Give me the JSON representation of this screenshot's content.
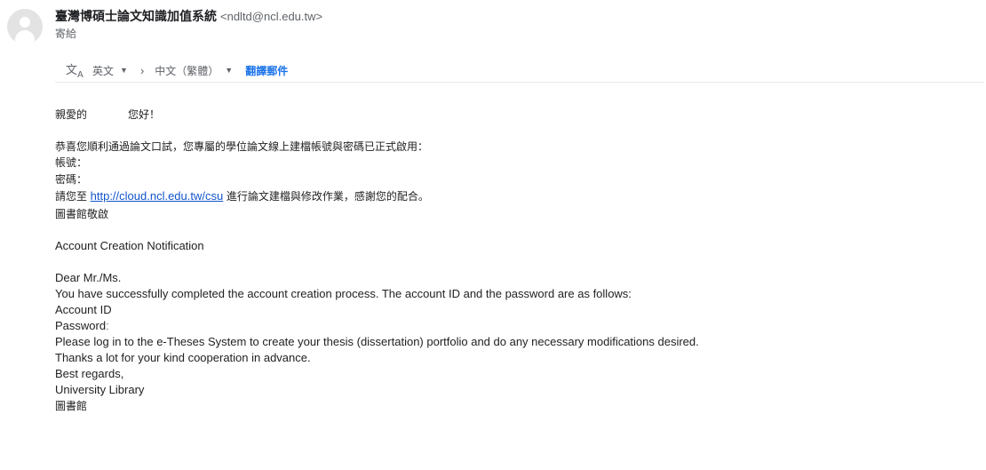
{
  "sender": {
    "name": "臺灣博碩士論文知識加值系統",
    "email": "<ndltd@ncl.edu.tw>",
    "to_label": "寄給"
  },
  "translate_bar": {
    "source_lang": "英文",
    "target_lang": "中文（繁體）",
    "arrow": "›",
    "action": "翻譯郵件"
  },
  "message": {
    "greeting_prefix": "親愛的",
    "greeting_suffix": "您好！",
    "cn_line1": "恭喜您順利通過論文口試，您專屬的學位論文線上建檔帳號與密碼已正式啟用：",
    "cn_account_label": "帳號：",
    "cn_password_label": "密碼：",
    "cn_visit_prefix": "請您至",
    "cn_link": "http://cloud.ncl.edu.tw/csu",
    "cn_visit_suffix": "進行論文建檔與修改作業，感謝您的配合。",
    "cn_signoff": "圖書館敬啟",
    "en_title": "Account Creation Notification",
    "en_dear": "Dear Mr./Ms.",
    "en_line1": "You have successfully completed the account creation process. The account ID and the password are as follows:",
    "en_account": "Account ID",
    "en_password": "Passwordː",
    "en_login": "Please log in to the e-Theses System to create your thesis (dissertation) portfolio and do any necessary modifications desired.",
    "en_thanks": "Thanks a lot for your kind cooperation in advance.",
    "en_regards": "Best regards,",
    "en_library": "University Library",
    "cn_library": "圖書館"
  },
  "colors": {
    "link": "#1155cc",
    "translate_action": "#1a73e8",
    "avatar_bg": "#e3e3e3"
  },
  "icons": {
    "avatar": "person-icon",
    "translate": "translate-icon",
    "caret": "caret-down-icon"
  }
}
